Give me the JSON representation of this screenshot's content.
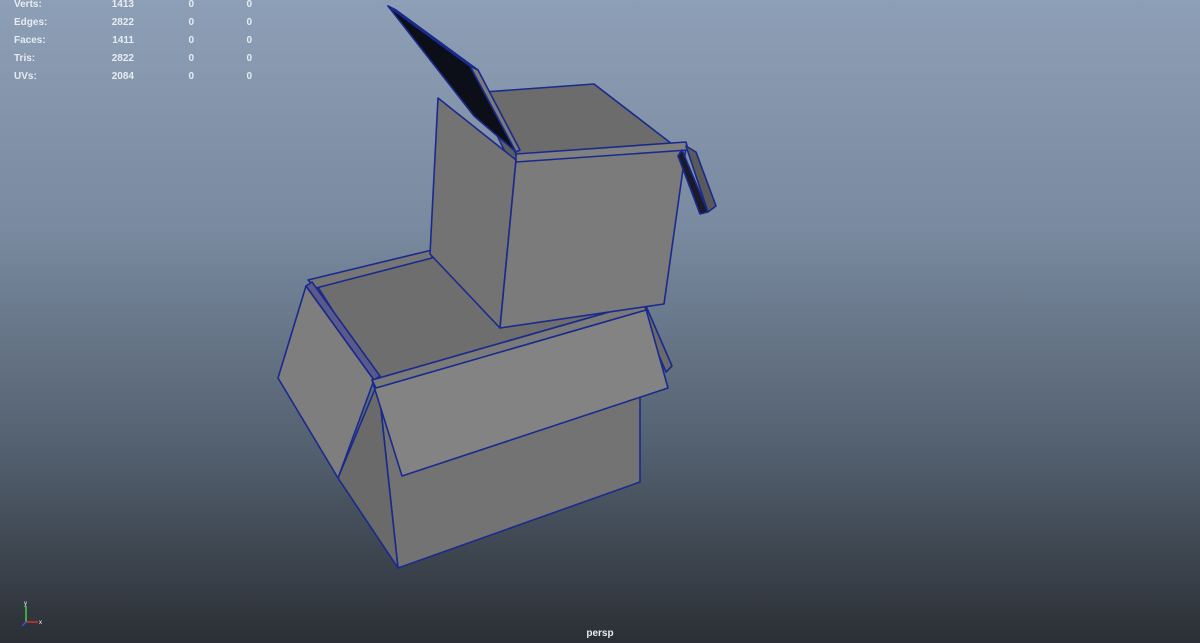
{
  "hud": {
    "rows": [
      {
        "label": "Verts:",
        "values": [
          "1413",
          "0",
          "0"
        ]
      },
      {
        "label": "Edges:",
        "values": [
          "2822",
          "0",
          "0"
        ]
      },
      {
        "label": "Faces:",
        "values": [
          "1411",
          "0",
          "0"
        ]
      },
      {
        "label": "Tris:",
        "values": [
          "2822",
          "0",
          "0"
        ]
      },
      {
        "label": "UVs:",
        "values": [
          "2084",
          "0",
          "0"
        ]
      }
    ]
  },
  "viewport": {
    "camera": "persp",
    "colors": {
      "face_light": "#7f7f7f",
      "face_mid": "#727272",
      "face_dark": "#5e5e5e",
      "wireframe": "#1a2a8c",
      "lid_inner": "#0d0f18"
    }
  },
  "axis_gizmo": {
    "y": "y",
    "x": "x"
  }
}
